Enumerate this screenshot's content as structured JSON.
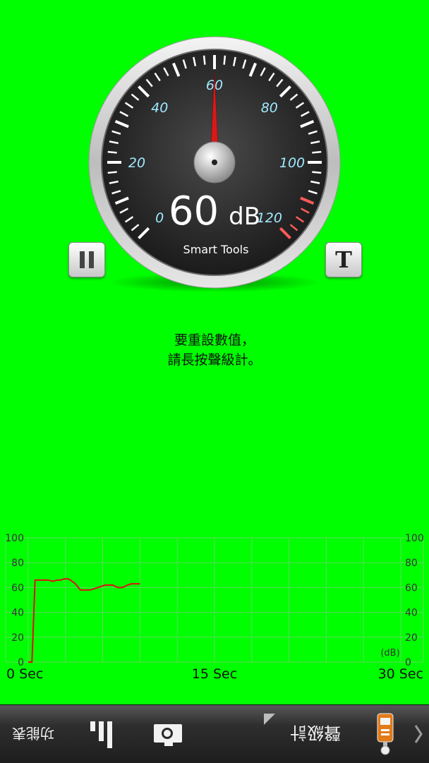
{
  "gauge": {
    "reading_value": "60",
    "reading_unit": "dB",
    "brand": "Smart Tools",
    "scale_labels": [
      "0",
      "20",
      "40",
      "60",
      "80",
      "100",
      "120"
    ],
    "needle_value": 60,
    "scale_min": 0,
    "scale_max": 120,
    "red_zone_start": 110
  },
  "buttons": {
    "text_label": "T"
  },
  "hint": {
    "line1": "要重設數值，",
    "line2": "請長按聲級計。"
  },
  "chart_data": {
    "type": "line",
    "x_label_start": "0 Sec",
    "x_label_mid": "15 Sec",
    "x_label_end": "30 Sec",
    "unit_label": "(dB)",
    "y_ticks": [
      "0",
      "20",
      "40",
      "60",
      "80",
      "100"
    ],
    "xlim": [
      0,
      30
    ],
    "ylim": [
      0,
      100
    ],
    "line_color": "#dd1111",
    "series": [
      {
        "x": [
          0.0,
          0.3,
          0.55,
          0.8,
          1.2,
          1.6,
          2.0,
          2.3,
          2.6,
          2.9,
          3.2,
          3.4,
          3.8,
          4.2,
          4.6,
          5.0,
          5.6,
          6.2,
          6.5,
          6.8,
          7.0,
          7.2,
          7.6,
          8.0,
          8.3,
          8.5,
          8.7,
          9.0
        ],
        "y": [
          0,
          0,
          66,
          66,
          66,
          66,
          65,
          66,
          66,
          67,
          67,
          66,
          63,
          58,
          58,
          58,
          60,
          62,
          62,
          62,
          61,
          60,
          60,
          62,
          63,
          63,
          63,
          63
        ]
      }
    ]
  },
  "bottom_bar": {
    "menu_label": "功能表",
    "sound_meter_label": "聲級計"
  },
  "colors": {
    "background": "#00ff00",
    "needle": "#d61a1a",
    "scale_text": "#9fe8ff"
  }
}
